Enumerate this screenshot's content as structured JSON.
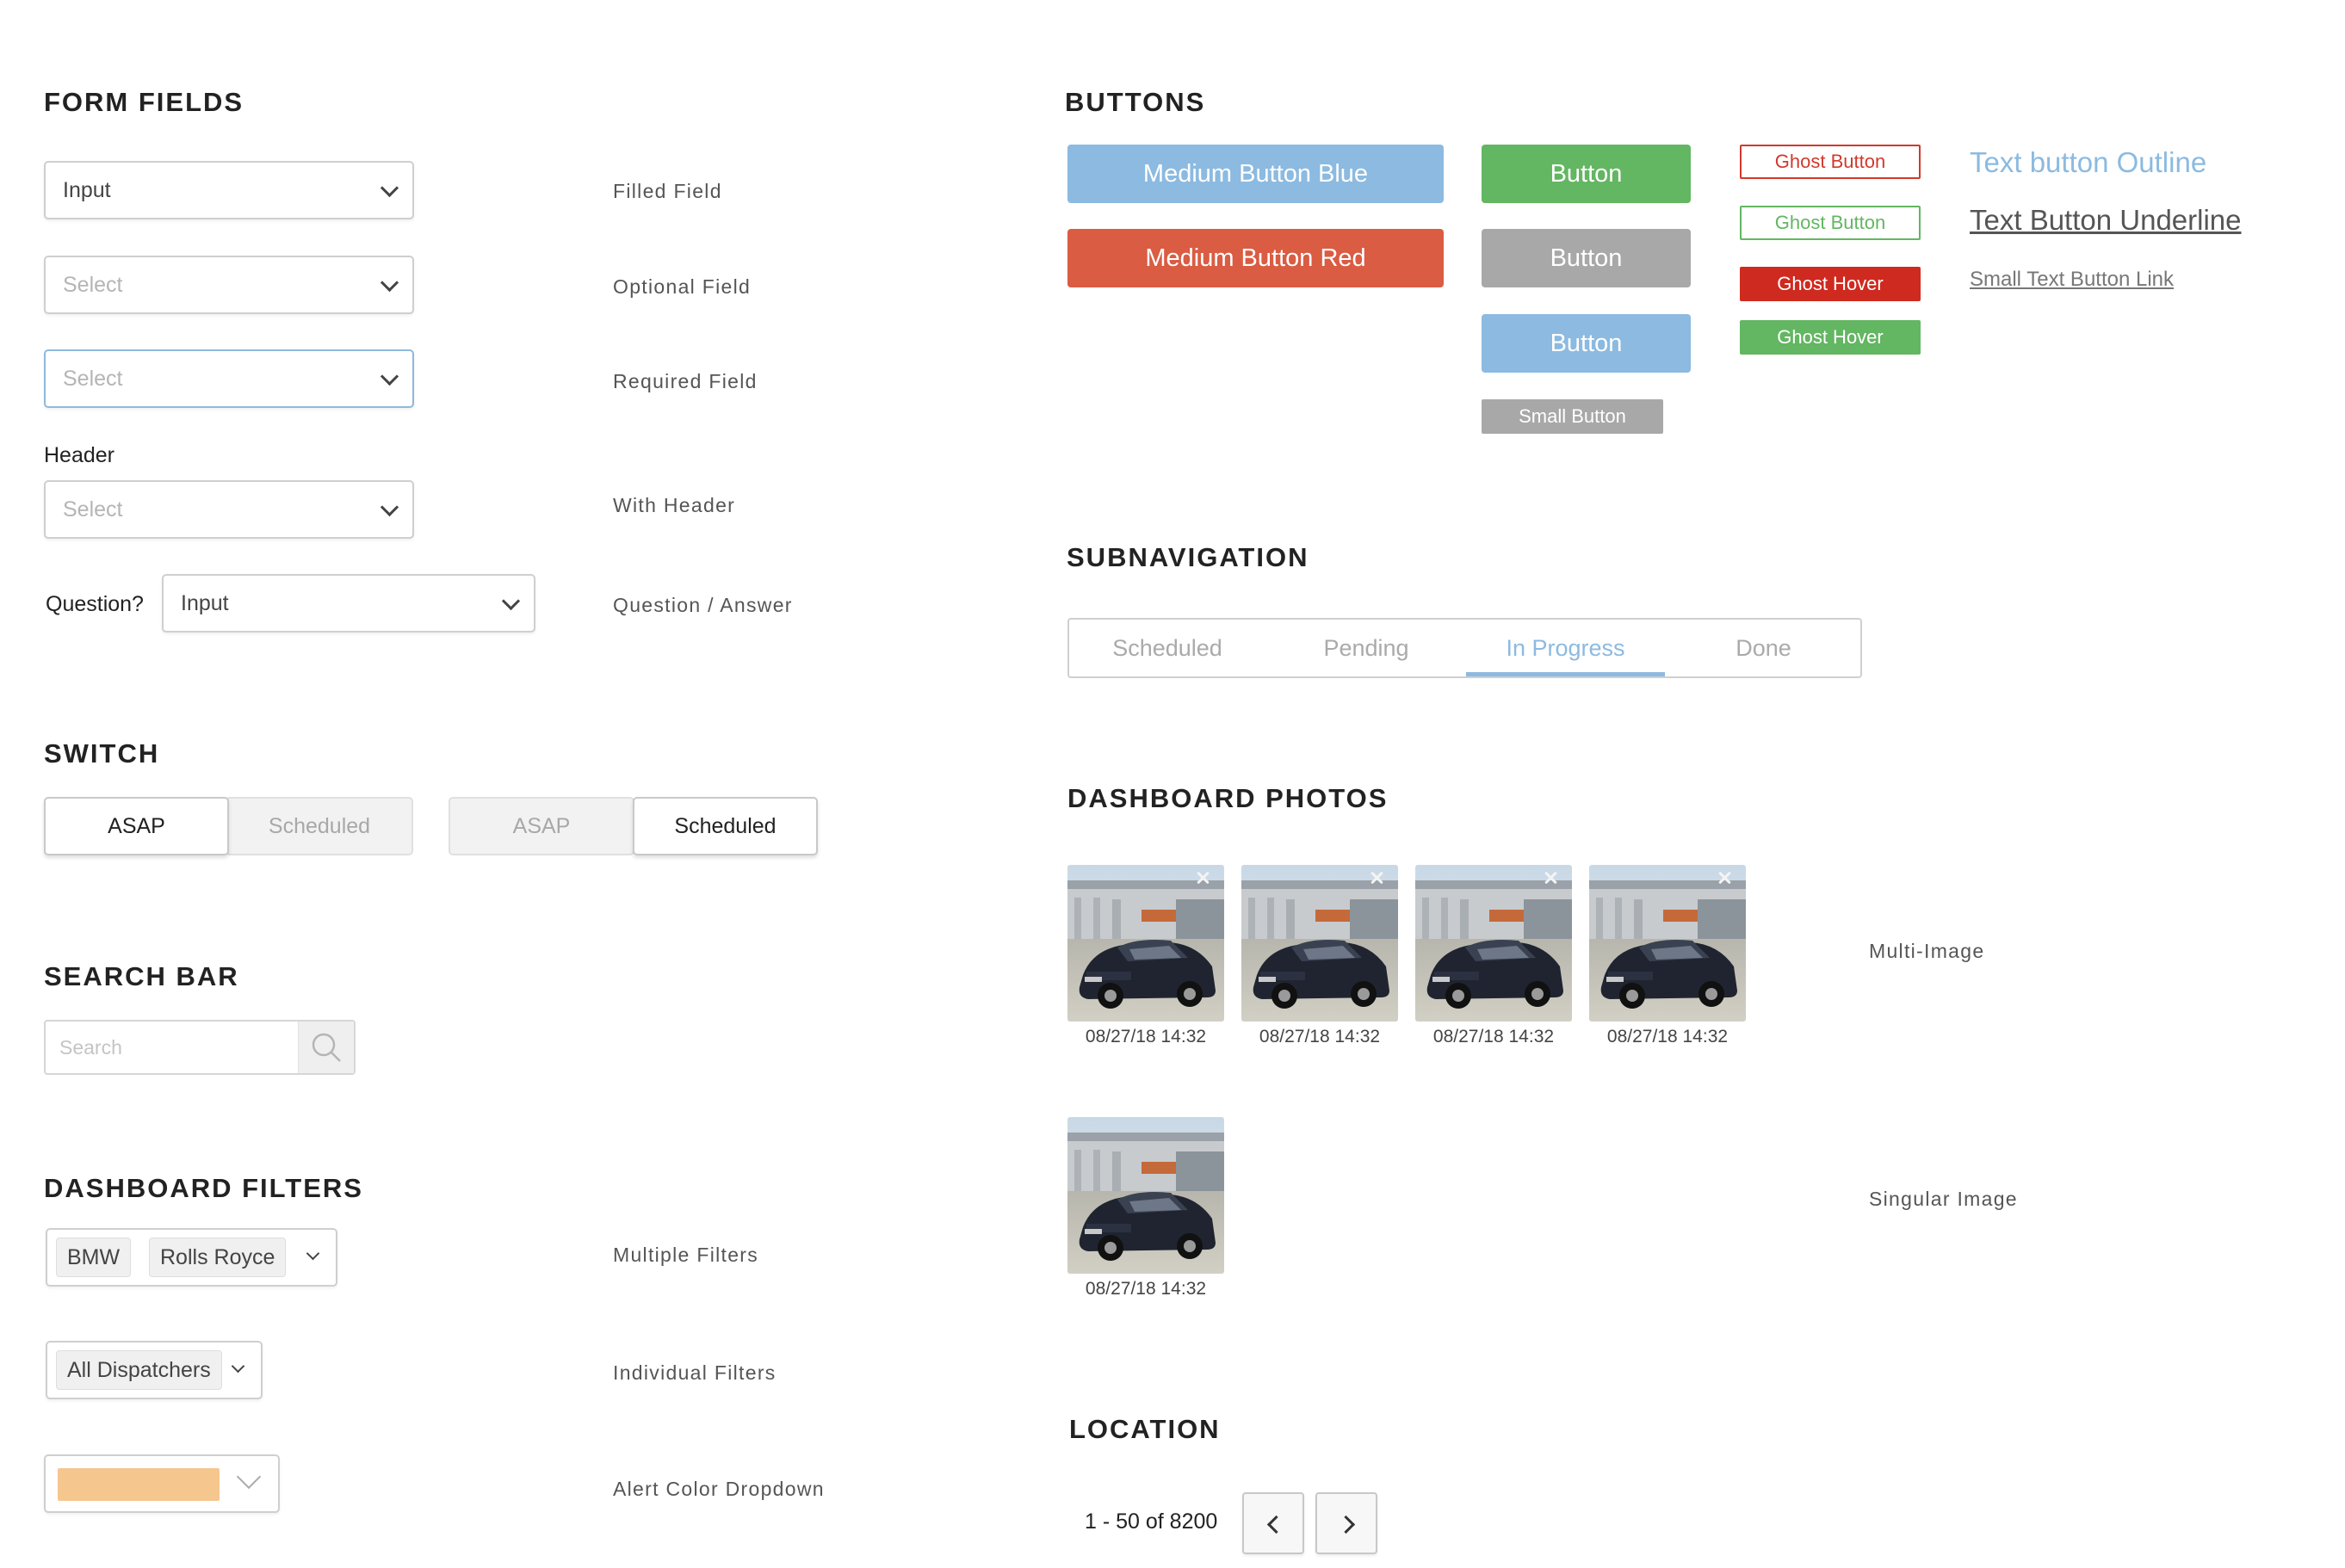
{
  "form_fields": {
    "title": "FORM FIELDS",
    "filled": {
      "value": "Input",
      "label": "Filled Field"
    },
    "optional": {
      "placeholder": "Select",
      "label": "Optional Field"
    },
    "required": {
      "placeholder": "Select",
      "label": "Required Field"
    },
    "with_header": {
      "header": "Header",
      "placeholder": "Select",
      "label": "With Header"
    },
    "question": {
      "question": "Question?",
      "value": "Input",
      "label": "Question / Answer"
    }
  },
  "switch": {
    "title": "SWITCH",
    "first": {
      "left": "ASAP",
      "right": "Scheduled"
    },
    "second": {
      "left": "ASAP",
      "right": "Scheduled"
    }
  },
  "search_bar": {
    "title": "SEARCH BAR",
    "placeholder": "Search"
  },
  "dashboard_filters": {
    "title": "DASHBOARD FILTERS",
    "multiple": {
      "chips": [
        "BMW",
        "Rolls Royce"
      ],
      "label": "Multiple Filters"
    },
    "individual": {
      "chip": "All Dispatchers",
      "label": "Individual Filters"
    },
    "alert_color": {
      "color": "#f6c68f",
      "label": "Alert Color Dropdown"
    }
  },
  "buttons": {
    "title": "BUTTONS",
    "medium_blue": "Medium Button Blue",
    "medium_red": "Medium Button Red",
    "button_green": "Button",
    "button_grey": "Button",
    "button_blue": "Button",
    "small_button": "Small Button",
    "ghost_red": "Ghost Button",
    "ghost_green": "Ghost Button",
    "ghost_hover_red": "Ghost Hover",
    "ghost_hover_green": "Ghost Hover",
    "text_outline": "Text button Outline",
    "text_underline": "Text Button Underline",
    "small_link": "Small Text Button Link",
    "colors": {
      "blue": "#8cbae0",
      "red": "#da5c43",
      "green": "#63b662",
      "grey": "#a8a8a8"
    }
  },
  "subnavigation": {
    "title": "SUBNAVIGATION",
    "tabs": [
      "Scheduled",
      "Pending",
      "In Progress",
      "Done"
    ],
    "active": "In Progress"
  },
  "dashboard_photos": {
    "title": "DASHBOARD PHOTOS",
    "multi": {
      "timestamps": [
        "08/27/18 14:32",
        "08/27/18 14:32",
        "08/27/18 14:32",
        "08/27/18 14:32"
      ],
      "label": "Multi-Image"
    },
    "single": {
      "timestamp": "08/27/18 14:32",
      "label": "Singular Image"
    }
  },
  "location": {
    "title": "LOCATION",
    "range": "1 - 50 of 8200"
  }
}
